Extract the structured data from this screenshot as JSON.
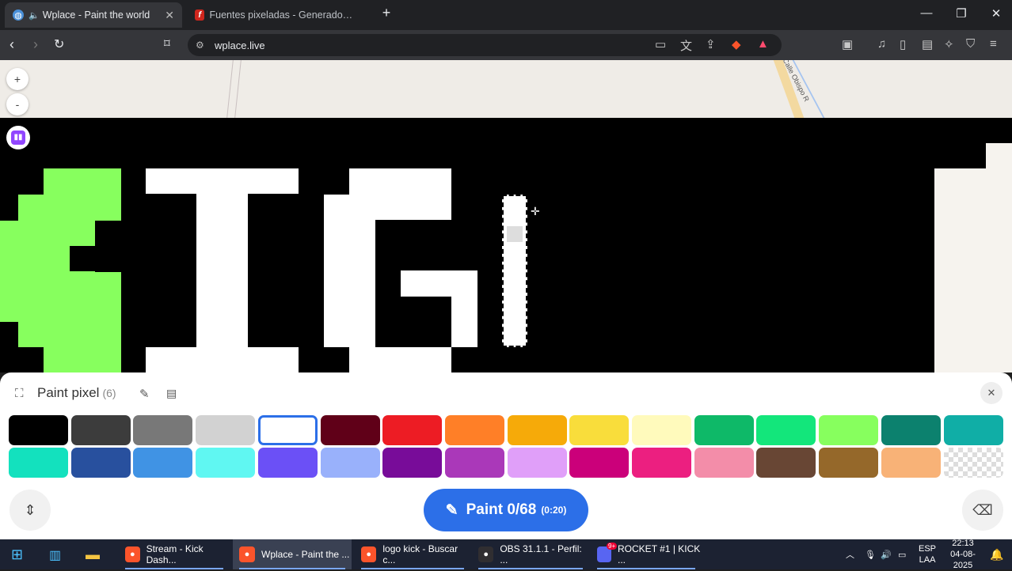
{
  "browser": {
    "tabs": [
      {
        "title": "Wplace - Paint the world",
        "active": true
      },
      {
        "title": "Fuentes pixeladas - Generador de fu",
        "active": false
      }
    ],
    "url": "wplace.live"
  },
  "map": {
    "zoom_in": "+",
    "zoom_out": "-",
    "street_label": "Calle Obispo R"
  },
  "panel": {
    "title": "Paint pixel",
    "count": "(6)",
    "colors_row1": [
      "#000000",
      "#3c3c3c",
      "#787878",
      "#d2d2d2",
      "#ffffff",
      "#600018",
      "#ed1c24",
      "#ff7f27",
      "#f6aa09",
      "#f9dd3b",
      "#fffabc",
      "#0eb968",
      "#13e67b",
      "#87ff5e",
      "#0c816e",
      "#10aea6"
    ],
    "colors_row2": [
      "#13e1be",
      "#28509e",
      "#4093e4",
      "#60f7f2",
      "#6b50f6",
      "#99b1fb",
      "#780c99",
      "#aa38b9",
      "#e09ff9",
      "#cb007a",
      "#ec1f80",
      "#f38da9",
      "#684634",
      "#95682a",
      "#f8b277",
      "transparent"
    ],
    "selected_index": 4,
    "paint_button": {
      "label": "Paint",
      "count": "0/68",
      "timer": "(0:20)"
    }
  },
  "taskbar": {
    "items": [
      {
        "label": "Stream - Kick Dash...",
        "icon": "brave-icon",
        "color": "#fb542b"
      },
      {
        "label": "Wplace - Paint the ...",
        "icon": "brave-icon",
        "color": "#fb542b",
        "active": true
      },
      {
        "label": "logo kick - Buscar c...",
        "icon": "brave-icon",
        "color": "#fb542b"
      },
      {
        "label": "OBS 31.1.1 - Perfil: ...",
        "icon": "obs-icon",
        "color": "#302e31"
      },
      {
        "label": "ROCKET #1 | KICK ...",
        "icon": "discord-icon",
        "color": "#5865f2",
        "badge": "9+"
      }
    ],
    "lang": "ESP",
    "lang2": "LAA",
    "time": "22:13",
    "date": "04-08-2025"
  }
}
